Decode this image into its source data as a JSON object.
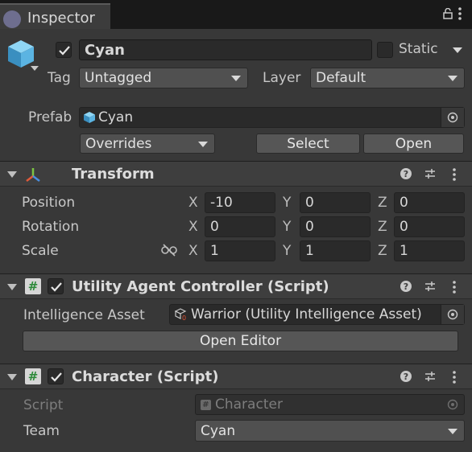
{
  "window": {
    "tab_title": "Inspector"
  },
  "object": {
    "name": "Cyan",
    "static_label": "Static",
    "tag_label": "Tag",
    "tag_value": "Untagged",
    "layer_label": "Layer",
    "layer_value": "Default",
    "prefab_label": "Prefab",
    "prefab_value": "Cyan",
    "overrides_label": "Overrides",
    "select_label": "Select",
    "open_label": "Open"
  },
  "transform": {
    "title": "Transform",
    "position": {
      "label": "Position",
      "x": "-10",
      "y": "0",
      "z": "0"
    },
    "rotation": {
      "label": "Rotation",
      "x": "0",
      "y": "0",
      "z": "0"
    },
    "scale": {
      "label": "Scale",
      "x": "1",
      "y": "1",
      "z": "1"
    },
    "axes": {
      "x": "X",
      "y": "Y",
      "z": "Z"
    }
  },
  "utility": {
    "title": "Utility Agent Controller (Script)",
    "asset_label": "Intelligence Asset",
    "asset_value": "Warrior (Utility Intelligence Asset)",
    "open_editor_label": "Open Editor"
  },
  "character": {
    "title": "Character (Script)",
    "script_label": "Script",
    "script_value": "Character",
    "team_label": "Team",
    "team_value": "Cyan"
  },
  "icons": {
    "cube": "prefab-cube-icon",
    "transform": "transform-axes-icon",
    "script": "script-hash-icon"
  },
  "colors": {
    "background": "#383838",
    "field": "#2a2a2a",
    "button": "#565656",
    "accent_cyan": "#4fb4e6"
  }
}
